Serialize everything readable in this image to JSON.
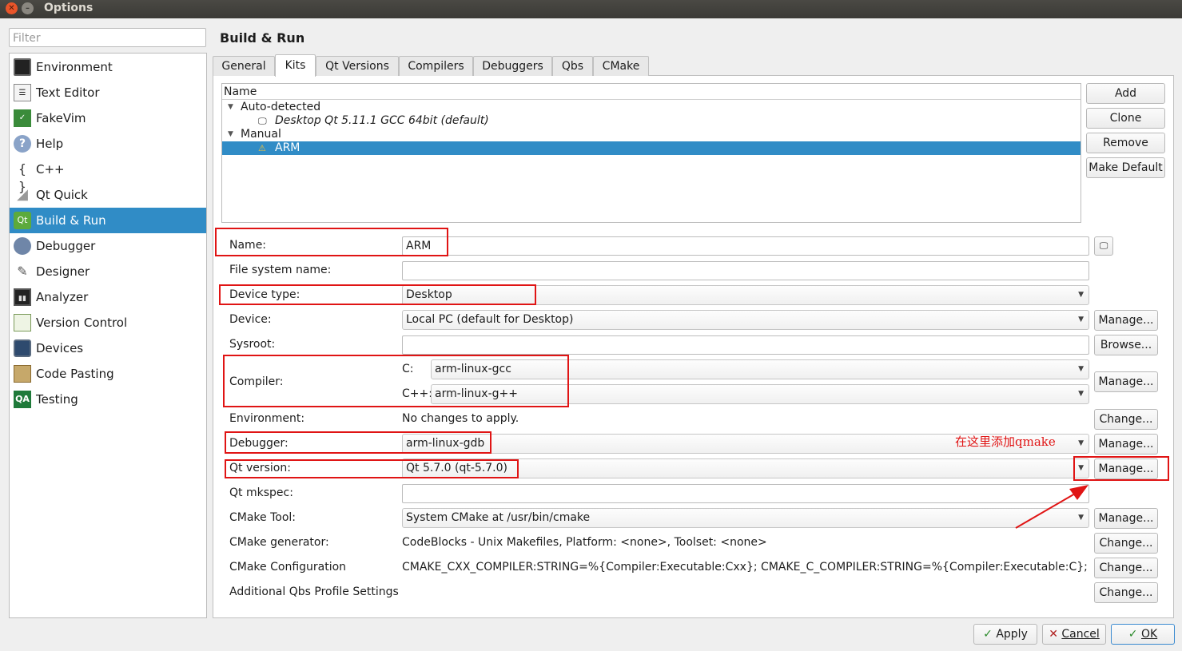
{
  "window": {
    "title": "Options"
  },
  "filter": {
    "placeholder": "Filter"
  },
  "categories": [
    {
      "label": "Environment",
      "icon": "monitor-icon"
    },
    {
      "label": "Text Editor",
      "icon": "text-editor-icon"
    },
    {
      "label": "FakeVim",
      "icon": "fakevim-icon"
    },
    {
      "label": "Help",
      "icon": "help-icon"
    },
    {
      "label": "C++",
      "icon": "braces-icon"
    },
    {
      "label": "Qt Quick",
      "icon": "qt-quick-icon"
    },
    {
      "label": "Build & Run",
      "icon": "qt-build-icon",
      "selected": true
    },
    {
      "label": "Debugger",
      "icon": "debugger-icon"
    },
    {
      "label": "Designer",
      "icon": "designer-icon"
    },
    {
      "label": "Analyzer",
      "icon": "analyzer-icon"
    },
    {
      "label": "Version Control",
      "icon": "version-control-icon"
    },
    {
      "label": "Devices",
      "icon": "device-icon"
    },
    {
      "label": "Code Pasting",
      "icon": "code-pasting-icon"
    },
    {
      "label": "Testing",
      "icon": "qa-icon"
    }
  ],
  "page": {
    "heading": "Build & Run"
  },
  "tabs": [
    "General",
    "Kits",
    "Qt Versions",
    "Compilers",
    "Debuggers",
    "Qbs",
    "CMake"
  ],
  "active_tab": "Kits",
  "kits_tree": {
    "header": "Name",
    "groups": [
      {
        "label": "Auto-detected",
        "items": [
          "Desktop Qt 5.11.1 GCC 64bit (default)"
        ]
      },
      {
        "label": "Manual",
        "items": [
          "ARM"
        ]
      }
    ],
    "selected": "ARM"
  },
  "kit_buttons": {
    "add": "Add",
    "clone": "Clone",
    "remove": "Remove",
    "make_default": "Make Default"
  },
  "kit": {
    "name_label": "Name:",
    "name_value": "ARM",
    "fs_label": "File system name:",
    "fs_value": "",
    "device_type_label": "Device type:",
    "device_type_value": "Desktop",
    "device_label": "Device:",
    "device_value": "Local PC (default for Desktop)",
    "sysroot_label": "Sysroot:",
    "sysroot_value": "",
    "compiler_label": "Compiler:",
    "compiler_c_label": "C:",
    "compiler_c_value": "arm-linux-gcc",
    "compiler_cpp_label": "C++:",
    "compiler_cpp_value": "arm-linux-g++",
    "environment_label": "Environment:",
    "environment_value": "No changes to apply.",
    "debugger_label": "Debugger:",
    "debugger_value": "arm-linux-gdb",
    "qt_version_label": "Qt version:",
    "qt_version_value": "Qt 5.7.0 (qt-5.7.0)",
    "qt_mkspec_label": "Qt mkspec:",
    "qt_mkspec_value": "",
    "cmake_tool_label": "CMake Tool:",
    "cmake_tool_value": "System CMake at /usr/bin/cmake",
    "cmake_generator_label": "CMake generator:",
    "cmake_generator_value": "CodeBlocks - Unix Makefiles, Platform: <none>, Toolset: <none>",
    "cmake_config_label": "CMake Configuration",
    "cmake_config_value": "CMAKE_CXX_COMPILER:STRING=%{Compiler:Executable:Cxx}; CMAKE_C_COMPILER:STRING=%{Compiler:Executable:C}; CM…",
    "qbs_label": "Additional Qbs Profile Settings"
  },
  "side_buttons": {
    "manage": "Manage...",
    "browse": "Browse...",
    "change": "Change..."
  },
  "annotation": {
    "text": "在这里添加qmake",
    "color": "#e01414"
  },
  "dialog_buttons": {
    "apply": "Apply",
    "cancel": "Cancel",
    "ok": "OK"
  },
  "colors": {
    "selection": "#308cc6",
    "annotation": "#e01414"
  }
}
